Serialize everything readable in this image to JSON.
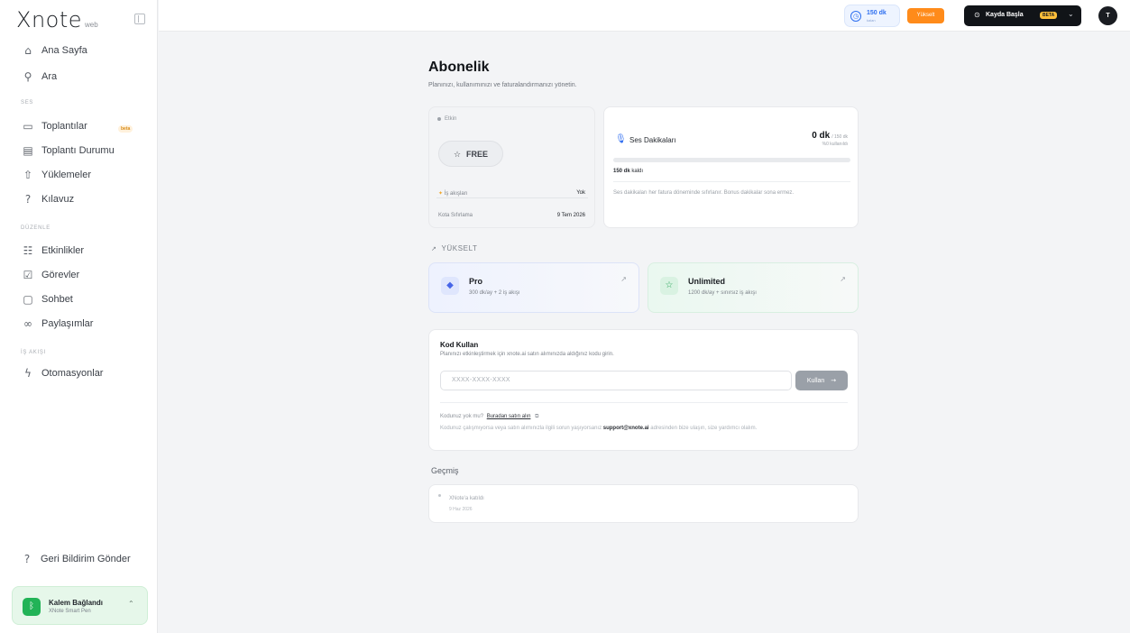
{
  "brand": {
    "logo": "Xnote",
    "suffix": "web"
  },
  "sidebar": {
    "primary": [
      {
        "label": "Ana Sayfa",
        "icon": "home-icon",
        "glyph": "⌂"
      },
      {
        "label": "Ara",
        "icon": "search-icon",
        "glyph": "⚲"
      }
    ],
    "section_ses": "SES",
    "ses_items": [
      {
        "label": "Toplantılar",
        "icon": "calendar-icon",
        "glyph": "▭",
        "badge": "beta"
      },
      {
        "label": "Toplantı Durumu",
        "icon": "clipboard-icon",
        "glyph": "▤"
      },
      {
        "label": "Yüklemeler",
        "icon": "upload-icon",
        "glyph": "⇧"
      },
      {
        "label": "Kılavuz",
        "icon": "help-icon",
        "glyph": "?"
      }
    ],
    "section_duzenle": "DÜZENLE",
    "duzenle_items": [
      {
        "label": "Etkinlikler",
        "icon": "activity-icon",
        "glyph": "☷"
      },
      {
        "label": "Görevler",
        "icon": "tasks-icon",
        "glyph": "☑"
      },
      {
        "label": "Sohbet",
        "icon": "chat-icon",
        "glyph": "▢"
      },
      {
        "label": "Paylaşımlar",
        "icon": "link-icon",
        "glyph": "∞"
      }
    ],
    "section_is_akisi": "İŞ AKIŞI",
    "is_akisi_items": [
      {
        "label": "Otomasyonlar",
        "icon": "automation-icon",
        "glyph": "ϟ"
      }
    ],
    "feedback": {
      "label": "Geri Bildirim Gönder",
      "icon": "help-icon",
      "glyph": "?"
    },
    "pen": {
      "title": "Kalem Bağlandı",
      "subtitle": "XNote Smart Pen"
    }
  },
  "topbar": {
    "credit_value": "150 dk",
    "credit_sub": "kalan",
    "upgrade_label": "Yükselt",
    "record_label": "Kayda Başla",
    "record_badge": "BETA",
    "avatar_initial": "T"
  },
  "page": {
    "title": "Abonelik",
    "subtitle": "Planınızı, kullanımınızı ve faturalandırmanızı yönetin."
  },
  "plan": {
    "status": "Etkin",
    "name": "FREE",
    "workflows_label": "İş akışları",
    "workflows_value": "Yok",
    "reset_label": "Kota Sıfırlama",
    "reset_value": "9 Tem 2026"
  },
  "minutes": {
    "title": "Ses Dakikaları",
    "value": "0 dk",
    "total": "/ 150 dk",
    "used": "%0 kullanıldı",
    "progress_fraction": 0.0,
    "left_value": "150 dk",
    "left_suffix": "kaldı",
    "note": "Ses dakikaları her fatura döneminde sıfırlanır. Bonus dakikalar sona ermez."
  },
  "upgrade_section": {
    "label": "YÜKSELT",
    "tiers": [
      {
        "name": "Pro",
        "desc": "300 dk/ay + 2 iş akışı",
        "icon": "diamond-icon",
        "glyph": "◆",
        "color": "#4665e8"
      },
      {
        "name": "Unlimited",
        "desc": "1200 dk/ay + sınırsız iş akışı",
        "icon": "star-icon",
        "glyph": "☆",
        "color": "#29a65a"
      }
    ]
  },
  "redeem": {
    "title": "Kod Kullan",
    "subtitle": "Planınızı etkinleştirmek için xnote.ai satın alımınızda aldığınız kodu girin.",
    "placeholder": "XXXX-XXXX-XXXX",
    "button": "Kullan",
    "no_code": "Kodunuz yok mu?",
    "buy_link": "Buradan satın alın",
    "support_prefix": "Kodunuz çalışmıyorsa veya satın alımınızla ilgili sorun yaşıyorsanız",
    "support_email": "support@xnote.ai",
    "support_suffix": "adresinden bize ulaşın, size yardımcı olalım."
  },
  "history": {
    "label": "Geçmiş",
    "items": [
      {
        "title": "XNote'a katıldı",
        "date": "9 Haz 2026"
      }
    ]
  },
  "colors": {
    "accent": "#2c6bf0",
    "upgrade": "#ff8b1a",
    "success": "#22b357",
    "record_bg": "#111418"
  }
}
